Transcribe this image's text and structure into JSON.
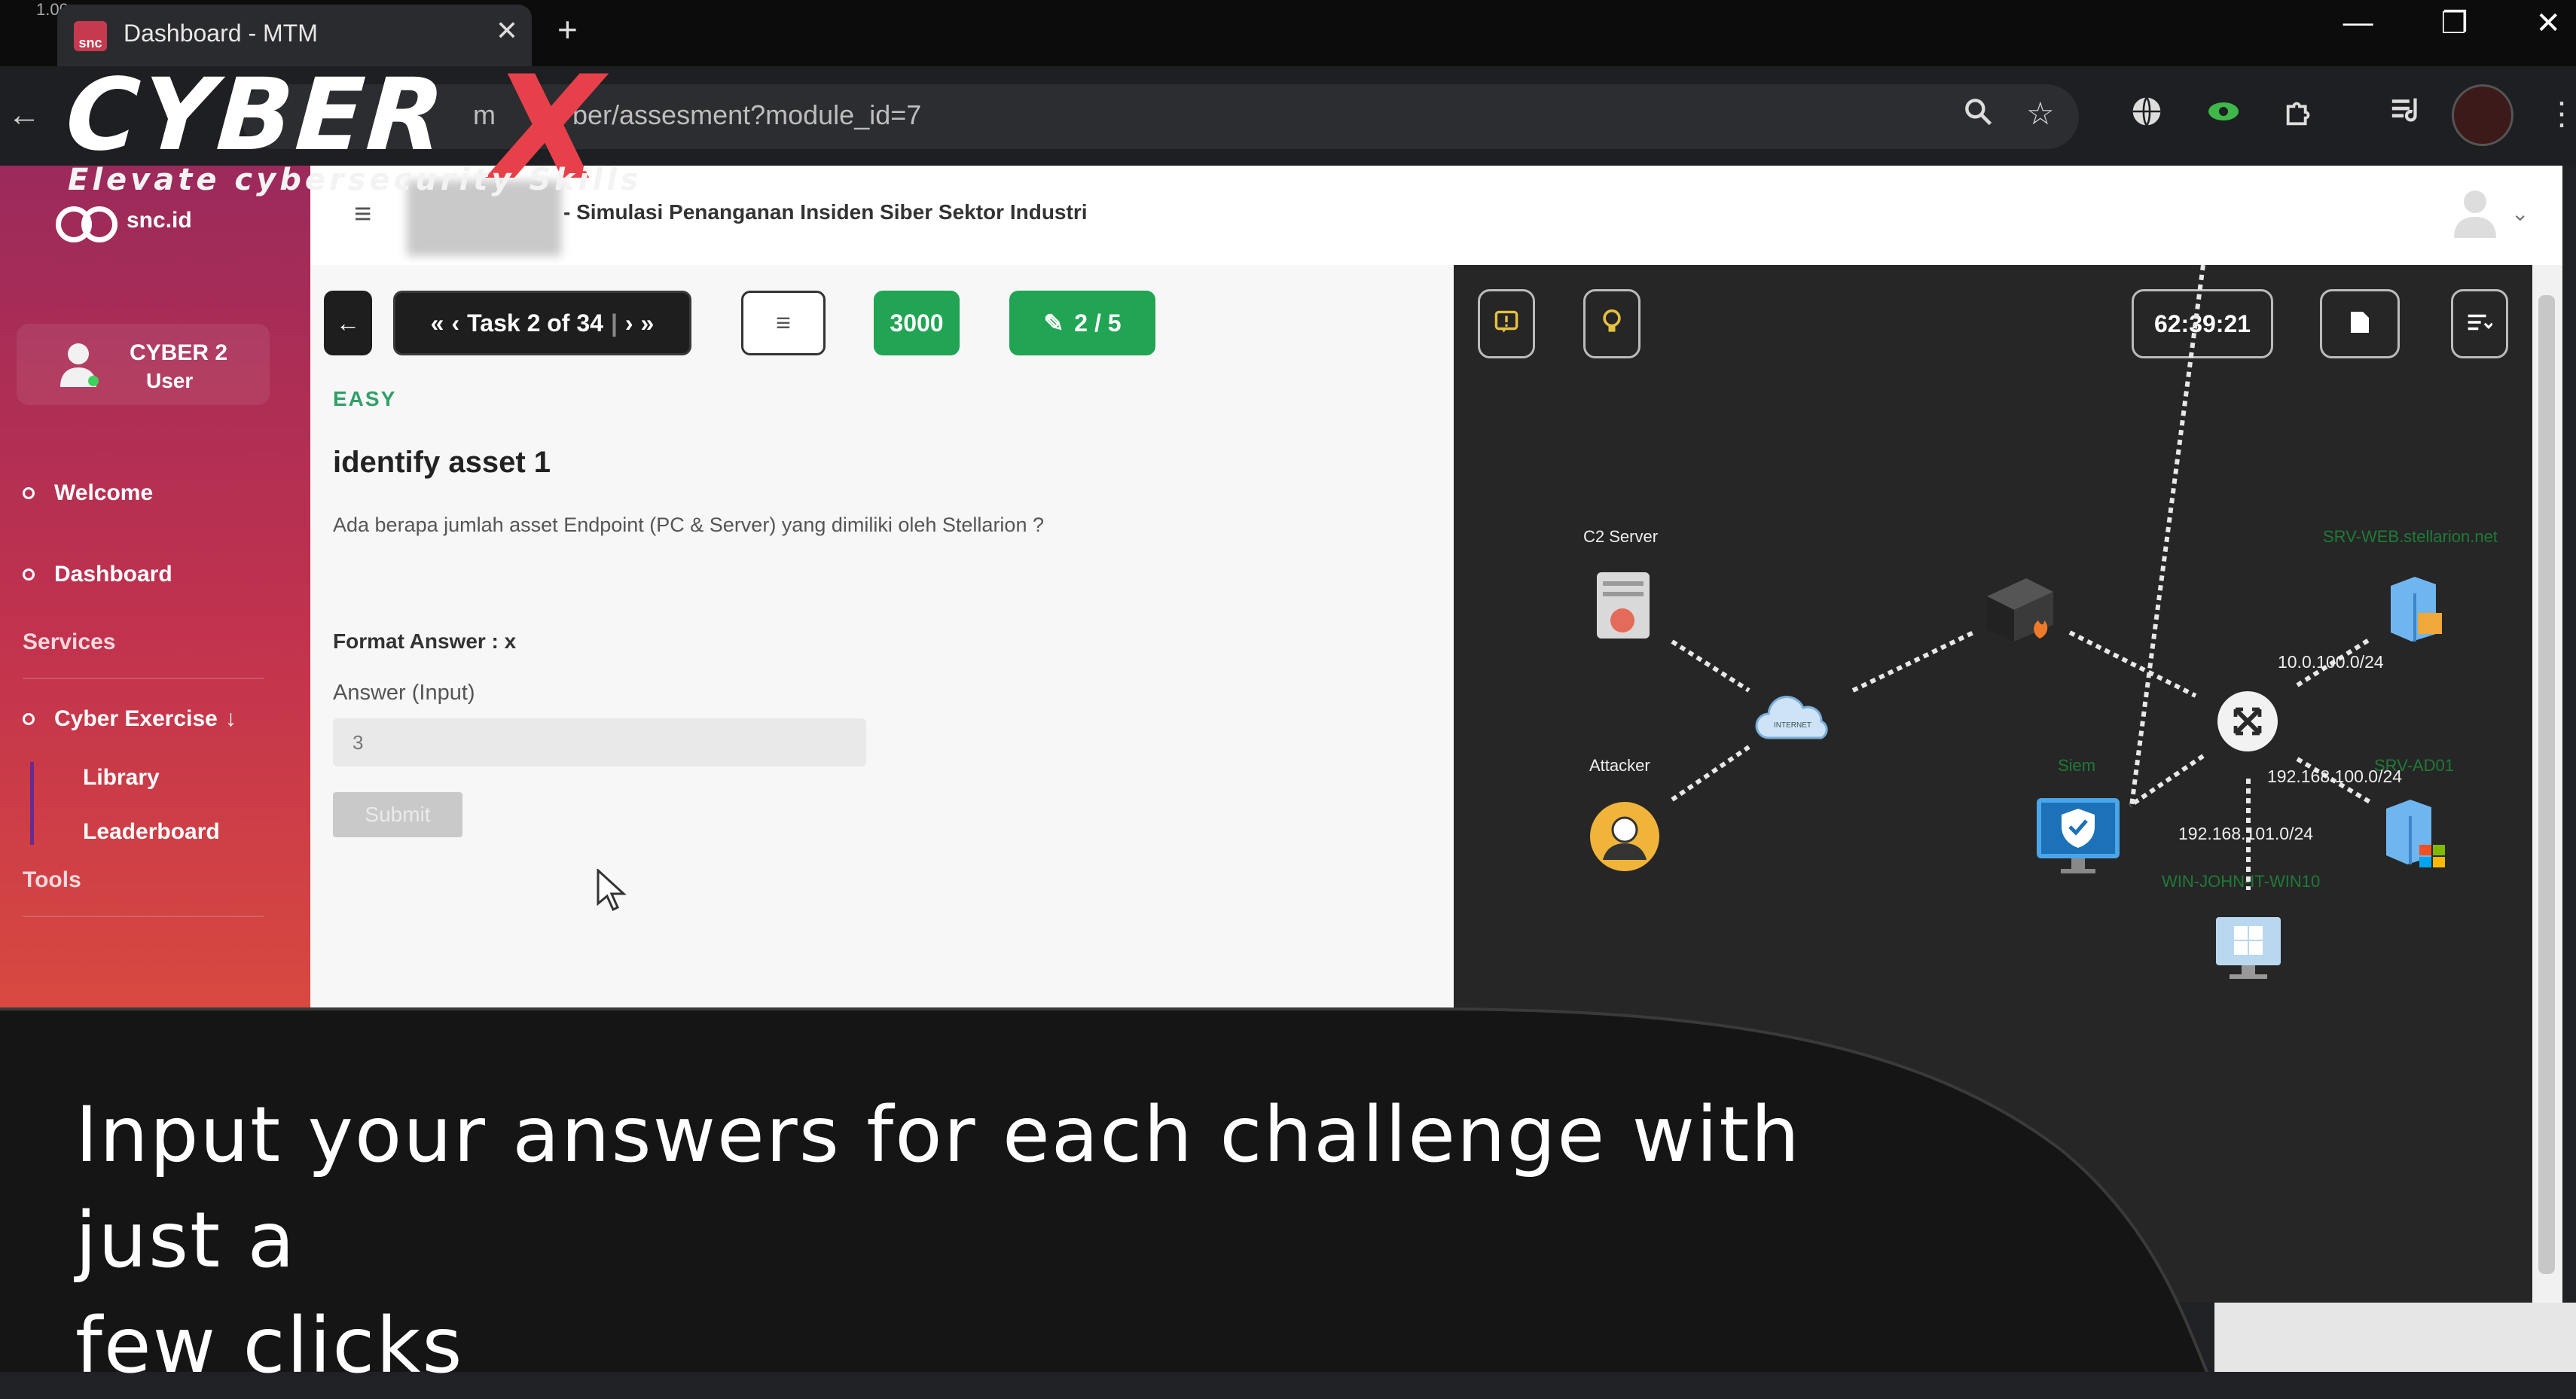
{
  "browser": {
    "version_text": "1.00",
    "tab_title": "Dashboard - MTM",
    "tab_favicon": "snc",
    "tab_close": "✕",
    "new_tab": "+",
    "url_visible": "ber/assesment?module_id=7",
    "url_prefix_fragment": "m",
    "window_controls": [
      "—",
      "❐",
      "✕"
    ]
  },
  "logo": {
    "word": "CYBER",
    "x": "X",
    "tagline": "Elevate cybersecurity Skills",
    "x_color": "#e8404a"
  },
  "sidebar": {
    "brand": "snc.id",
    "user_name": "CYBER 2",
    "user_role": "User",
    "items": [
      {
        "label": "Welcome"
      },
      {
        "label": "Dashboard"
      }
    ],
    "section_services": "Services",
    "cyber_exercise": "Cyber Exercise",
    "cyber_exercise_arrow": "↓",
    "sub_items": [
      "Library",
      "Leaderboard"
    ],
    "section_tools": "Tools",
    "gradient": [
      "#9b2a5b",
      "#d84940"
    ]
  },
  "header": {
    "hamburger": "≡",
    "title": "- Simulasi Penanganan Insiden Siber Sektor Industri",
    "user_caret": "⌄"
  },
  "task": {
    "back": "←",
    "nav_first": "«",
    "nav_prev": "‹",
    "label": "Task 2 of 34",
    "nav_next": "›",
    "nav_last": "»",
    "list_icon": "≡",
    "points": "3000",
    "attempts": "2 / 5",
    "difficulty": "EASY",
    "title": "identify asset 1",
    "question": "Ada berapa jumlah asset Endpoint (PC & Server) yang dimiliki oleh Stellarion ?",
    "format": "Format Answer : x",
    "answer_label": "Answer (Input)",
    "answer_value": "3",
    "submit": "Submit",
    "accent": "#21a453"
  },
  "network": {
    "timer": "62:39:21",
    "nodes": {
      "c2": "C2 Server",
      "attacker": "Attacker",
      "srv_web": "SRV-WEB.stellarion.net",
      "siem": "Siem",
      "srv_ad": "SRV-AD01",
      "win": "WIN-JOHN-IT-WIN10",
      "internet": "INTERNET"
    },
    "ips": {
      "a": "10.0.100.0/24",
      "b": "192.168.100.0/24",
      "c": "192.168.101.0/24"
    }
  },
  "caption": {
    "line1": "Input your answers for each challenge with just a",
    "line2": "few clicks"
  }
}
